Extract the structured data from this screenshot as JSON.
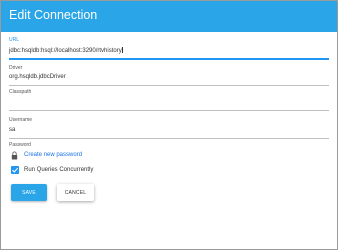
{
  "dialog": {
    "title": "Edit Connection"
  },
  "form": {
    "url": {
      "label": "URL",
      "value": "jdbc:hsqldb:hsql://localhost:3290/rtvhistory"
    },
    "driver": {
      "label": "Driver",
      "value": "org.hsqldb.jdbcDriver"
    },
    "classpath": {
      "label": "Classpath",
      "value": ""
    },
    "username": {
      "label": "Username",
      "value": "sa"
    },
    "password": {
      "label": "Password",
      "link_text": "Create new password"
    },
    "run_concurrently": {
      "label": "Run Queries Concurrently",
      "checked": true
    }
  },
  "actions": {
    "save_label": "SAVE",
    "cancel_label": "CANCEL"
  },
  "colors": {
    "header": "#29a5e8",
    "accent": "#2196f3",
    "link": "#1a73e8"
  },
  "icons": {
    "password": "lock-icon",
    "checkbox": "check-icon"
  }
}
